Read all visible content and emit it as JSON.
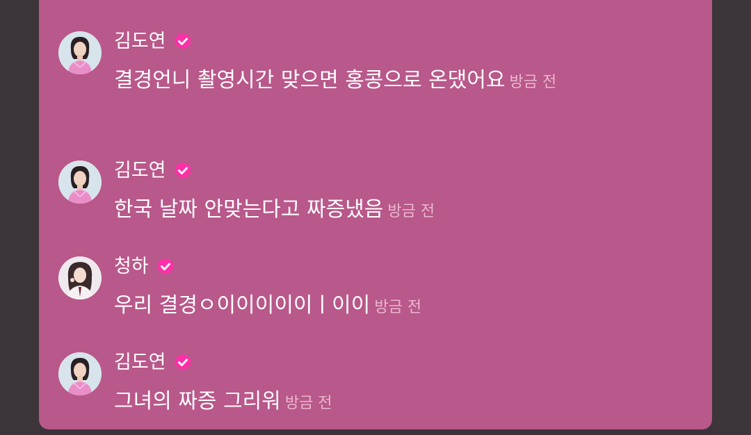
{
  "colors": {
    "panel": "#b9588a",
    "background": "#3a3438",
    "text": "#ffffff",
    "timestamp": "#eab7d0",
    "verified_badge": "#ff2fa8"
  },
  "messages": [
    {
      "author": "김도연",
      "verified": true,
      "avatar_icon": "avatar-kim-doyeon",
      "text": "결경언니 촬영시간 맞으면 홍콩으로 온댔어요",
      "time": "방금 전"
    },
    {
      "author": "김도연",
      "verified": true,
      "avatar_icon": "avatar-kim-doyeon",
      "text": "한국 날짜 안맞는다고 짜증냈음",
      "time": "방금 전"
    },
    {
      "author": "청하",
      "verified": true,
      "avatar_icon": "avatar-chungha",
      "text": "우리 결경ㅇ이이이이이ㅣ이이",
      "time": "방금 전"
    },
    {
      "author": "김도연",
      "verified": true,
      "avatar_icon": "avatar-kim-doyeon",
      "text": "그녀의 짜증 그리워",
      "time": "방금 전"
    }
  ]
}
